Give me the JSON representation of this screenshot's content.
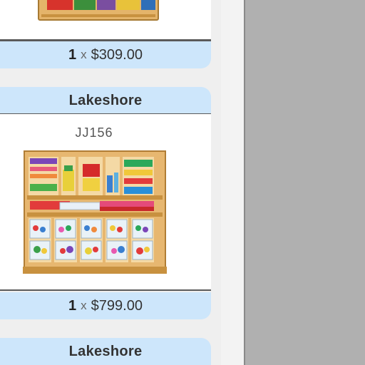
{
  "items": [
    {
      "quantity": "1",
      "times": "x",
      "price": "$309.00"
    },
    {
      "brand": "Lakeshore",
      "sku": "JJ156",
      "image_alt": "wooden classroom storage cubby unit with art supplies",
      "quantity": "1",
      "times": "x",
      "price": "$799.00"
    },
    {
      "brand": "Lakeshore"
    }
  ],
  "colors": {
    "header_bg": "#cde6fb",
    "card_bg": "#ffffff",
    "side_bg": "#b0b0b0"
  }
}
